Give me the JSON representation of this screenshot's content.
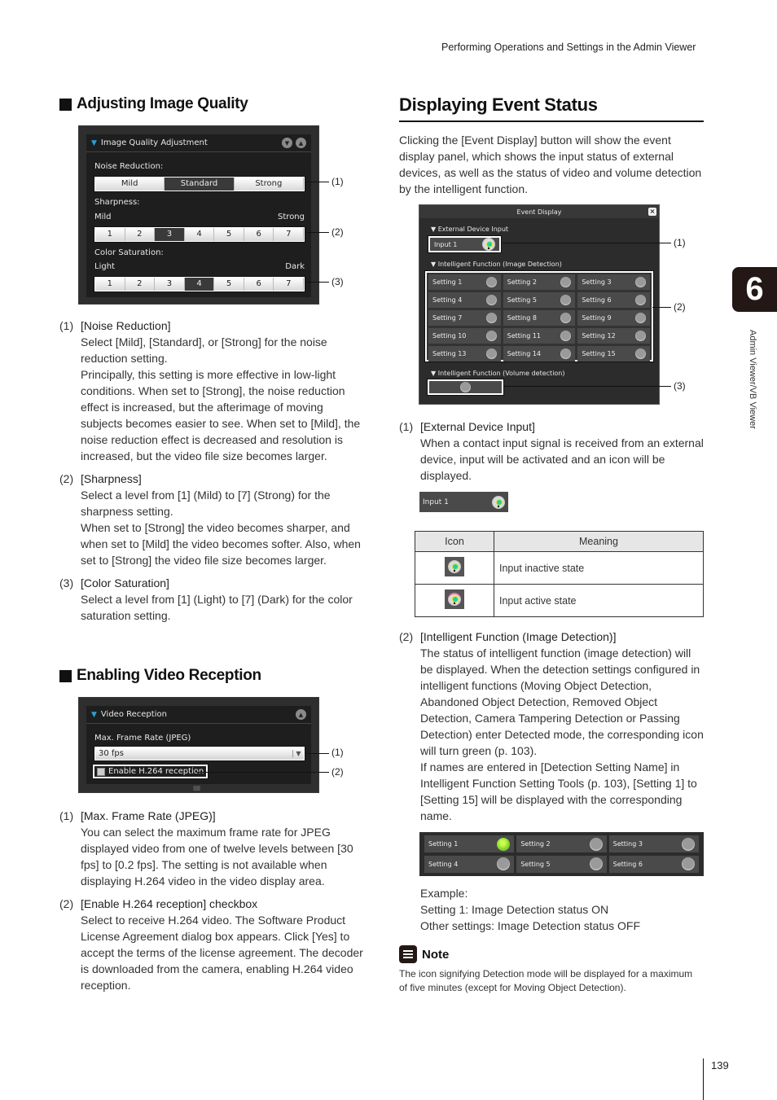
{
  "running_head": "Performing Operations and Settings in the Admin Viewer",
  "chapter_tab": {
    "number": "6",
    "label": "Admin Viewer/VB Viewer"
  },
  "page_number": "139",
  "left": {
    "section1": {
      "title": "Adjusting Image Quality",
      "panel": {
        "title": "Image Quality Adjustment",
        "noise_label": "Noise Reduction:",
        "noise_options": [
          "Mild",
          "Standard",
          "Strong"
        ],
        "noise_selected": "Standard",
        "sharpness_label": "Sharpness:",
        "sharpness_min": "Mild",
        "sharpness_max": "Strong",
        "levels": [
          "1",
          "2",
          "3",
          "4",
          "5",
          "6",
          "7"
        ],
        "sharpness_selected": "3",
        "color_label": "Color Saturation:",
        "color_min": "Light",
        "color_max": "Dark",
        "color_selected": "4"
      },
      "callouts": [
        "(1)",
        "(2)",
        "(3)"
      ],
      "items": [
        {
          "num": "(1)",
          "title": "[Noise Reduction]",
          "desc": "Select [Mild], [Standard], or [Strong] for the noise reduction setting.\nPrincipally, this setting is more effective in low-light conditions. When set to [Strong], the noise reduction effect is increased, but the afterimage of moving subjects becomes easier to see. When set to [Mild], the noise reduction effect is decreased and resolution is increased, but the video file size becomes larger."
        },
        {
          "num": "(2)",
          "title": "[Sharpness]",
          "desc": "Select a level from [1] (Mild) to [7] (Strong) for the sharpness setting.\nWhen set to [Strong] the video becomes sharper, and when set to [Mild] the video becomes softer. Also, when set to [Strong] the video file size becomes larger."
        },
        {
          "num": "(3)",
          "title": "[Color Saturation]",
          "desc": "Select a level from [1] (Light) to [7] (Dark) for the color saturation setting."
        }
      ]
    },
    "section2": {
      "title": "Enabling Video Reception",
      "panel": {
        "title": "Video Reception",
        "frame_rate_label": "Max. Frame Rate (JPEG)",
        "frame_rate_value": "30 fps",
        "h264_label": "Enable H.264 reception",
        "h264_checked": false
      },
      "callouts": [
        "(1)",
        "(2)"
      ],
      "items": [
        {
          "num": "(1)",
          "title": "[Max. Frame Rate (JPEG)]",
          "desc": "You can select the maximum frame rate for JPEG displayed video from one of twelve levels between [30 fps] to [0.2 fps]. The setting is not available when displaying H.264 video in the video display area."
        },
        {
          "num": "(2)",
          "title": "[Enable H.264 reception] checkbox",
          "desc": "Select to receive H.264 video. The Software Product License Agreement dialog box appears. Click [Yes] to accept the terms of the license agreement. The decoder is downloaded from the camera, enabling H.264 video reception."
        }
      ]
    }
  },
  "right": {
    "title": "Displaying Event Status",
    "intro": "Clicking the [Event Display] button will show the event display panel, which shows the input status of external devices, as well as the status of video and volume detection by the intelligent function.",
    "panel": {
      "title": "Event Display",
      "ext_header": "External Device Input",
      "input_label": "Input 1",
      "img_header": "Intelligent Function (Image Detection)",
      "settings": [
        "Setting 1",
        "Setting 2",
        "Setting 3",
        "Setting 4",
        "Setting 5",
        "Setting 6",
        "Setting 7",
        "Setting 8",
        "Setting 9",
        "Setting 10",
        "Setting 11",
        "Setting 12",
        "Setting 13",
        "Setting 14",
        "Setting 15"
      ],
      "vol_header": "Intelligent Function (Volume detection)"
    },
    "callouts": [
      "(1)",
      "(2)",
      "(3)"
    ],
    "item1": {
      "num": "(1)",
      "title": "[External Device Input]",
      "desc": "When a contact input signal is received from an external device, input will be activated and an icon will be displayed."
    },
    "input_sample": "Input 1",
    "table": {
      "headers": [
        "Icon",
        "Meaning"
      ],
      "rows": [
        {
          "icon": "input-inactive-icon",
          "meaning": "Input inactive state"
        },
        {
          "icon": "input-active-icon",
          "meaning": "Input active state"
        }
      ]
    },
    "item2": {
      "num": "(2)",
      "title": "[Intelligent Function (Image Detection)]",
      "desc": "The status of intelligent function (image detection) will be displayed. When the detection settings configured in intelligent functions (Moving Object Detection, Abandoned Object Detection, Removed Object Detection, Camera Tampering Detection or Passing Detection) enter Detected mode, the corresponding icon will turn green (p. 103).\nIf names are entered in [Detection Setting Name] in Intelligent Function Setting Tools (p. 103), [Setting 1] to [Setting 15] will be displayed with the corresponding name."
    },
    "example_settings": [
      {
        "label": "Setting 1",
        "active": true
      },
      {
        "label": "Setting 2",
        "active": false
      },
      {
        "label": "Setting 3",
        "active": false
      },
      {
        "label": "Setting 4",
        "active": false
      },
      {
        "label": "Setting 5",
        "active": false
      },
      {
        "label": "Setting 6",
        "active": false
      }
    ],
    "example_text": [
      "Example:",
      "Setting 1: Image Detection status ON",
      "Other settings: Image Detection status OFF"
    ],
    "note": {
      "title": "Note",
      "text": "The icon signifying Detection mode will be displayed for a maximum of five minutes (except for Moving Object Detection)."
    }
  }
}
